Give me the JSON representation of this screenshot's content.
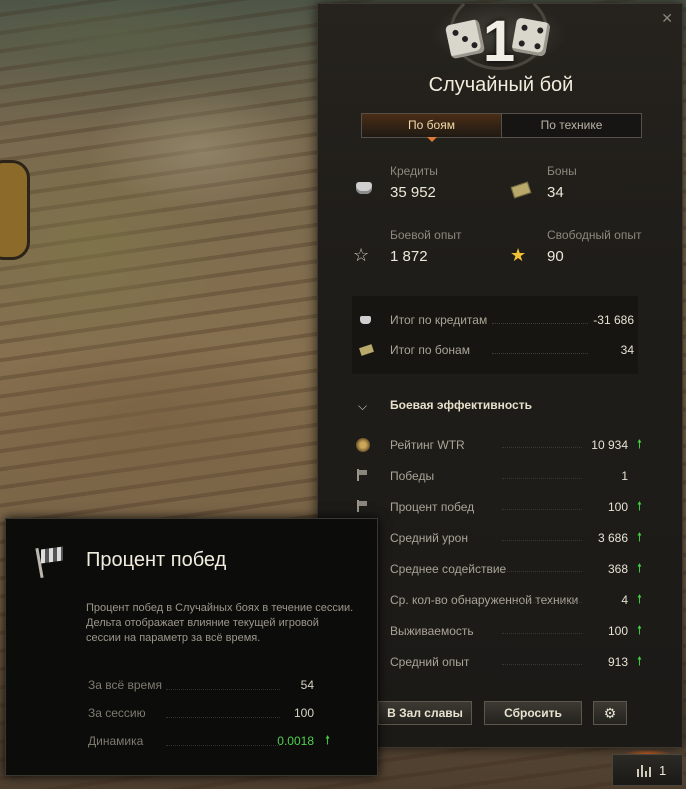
{
  "panel": {
    "battle_number": "1",
    "title": "Случайный бой",
    "tabs": [
      {
        "label": "По боям",
        "active": true
      },
      {
        "label": "По технике",
        "active": false
      }
    ],
    "stats": {
      "credits_label": "Кредиты",
      "credits_value": "35 952",
      "bonds_label": "Боны",
      "bonds_value": "34",
      "combat_xp_label": "Боевой опыт",
      "combat_xp_value": "1 872",
      "free_xp_label": "Свободный опыт",
      "free_xp_value": "90"
    },
    "summary": [
      {
        "label": "Итог по кредитам",
        "value": "-31 686",
        "icon": "credits-icon"
      },
      {
        "label": "Итог по бонам",
        "value": "34",
        "icon": "bonds-icon"
      }
    ],
    "efficiency": {
      "title": "Боевая эффективность",
      "rows": [
        {
          "label": "Рейтинг WTR",
          "value": "10 934",
          "up": true,
          "icon": "wtr-rating-icon"
        },
        {
          "label": "Победы",
          "value": "1",
          "up": false,
          "icon": "flag-icon"
        },
        {
          "label": "Процент побед",
          "value": "100",
          "up": true,
          "icon": "flag-icon"
        },
        {
          "label": "Средний урон",
          "value": "3 686",
          "up": true,
          "icon": "damage-icon"
        },
        {
          "label": "Среднее содействие",
          "value": "368",
          "up": true,
          "icon": "assist-icon"
        },
        {
          "label": "Ср. кол-во обнаруженной техники",
          "value": "4",
          "up": true,
          "icon": "spotted-icon"
        },
        {
          "label": "Выживаемость",
          "value": "100",
          "up": true,
          "icon": "survival-icon"
        },
        {
          "label": "Средний опыт",
          "value": "913",
          "up": true,
          "icon": "xp-icon"
        }
      ]
    },
    "buttons": {
      "hall_of_fame": "В Зал славы",
      "reset": "Сбросить",
      "settings_icon": "gear-icon"
    },
    "arrow_up_glyph": "🠕",
    "close_glyph": "✕",
    "chevron_glyph": "⌄"
  },
  "corner_button": {
    "icon": "bar-chart-icon",
    "count": "1"
  },
  "tooltip": {
    "title": "Процент побед",
    "description": "Процент побед в Случайных боях в течение сессии. Дельта отображает влияние текущей игровой сессии на параметр за всё время.",
    "rows": [
      {
        "label": "За всё время",
        "value": "54"
      },
      {
        "label": "За сессию",
        "value": "100"
      },
      {
        "label": "Динамика",
        "value": "0.0018"
      }
    ]
  },
  "colors": {
    "accent_orange": "#e07a30",
    "positive_green": "#3fd43f",
    "panel_bg": "#1f1d19"
  }
}
